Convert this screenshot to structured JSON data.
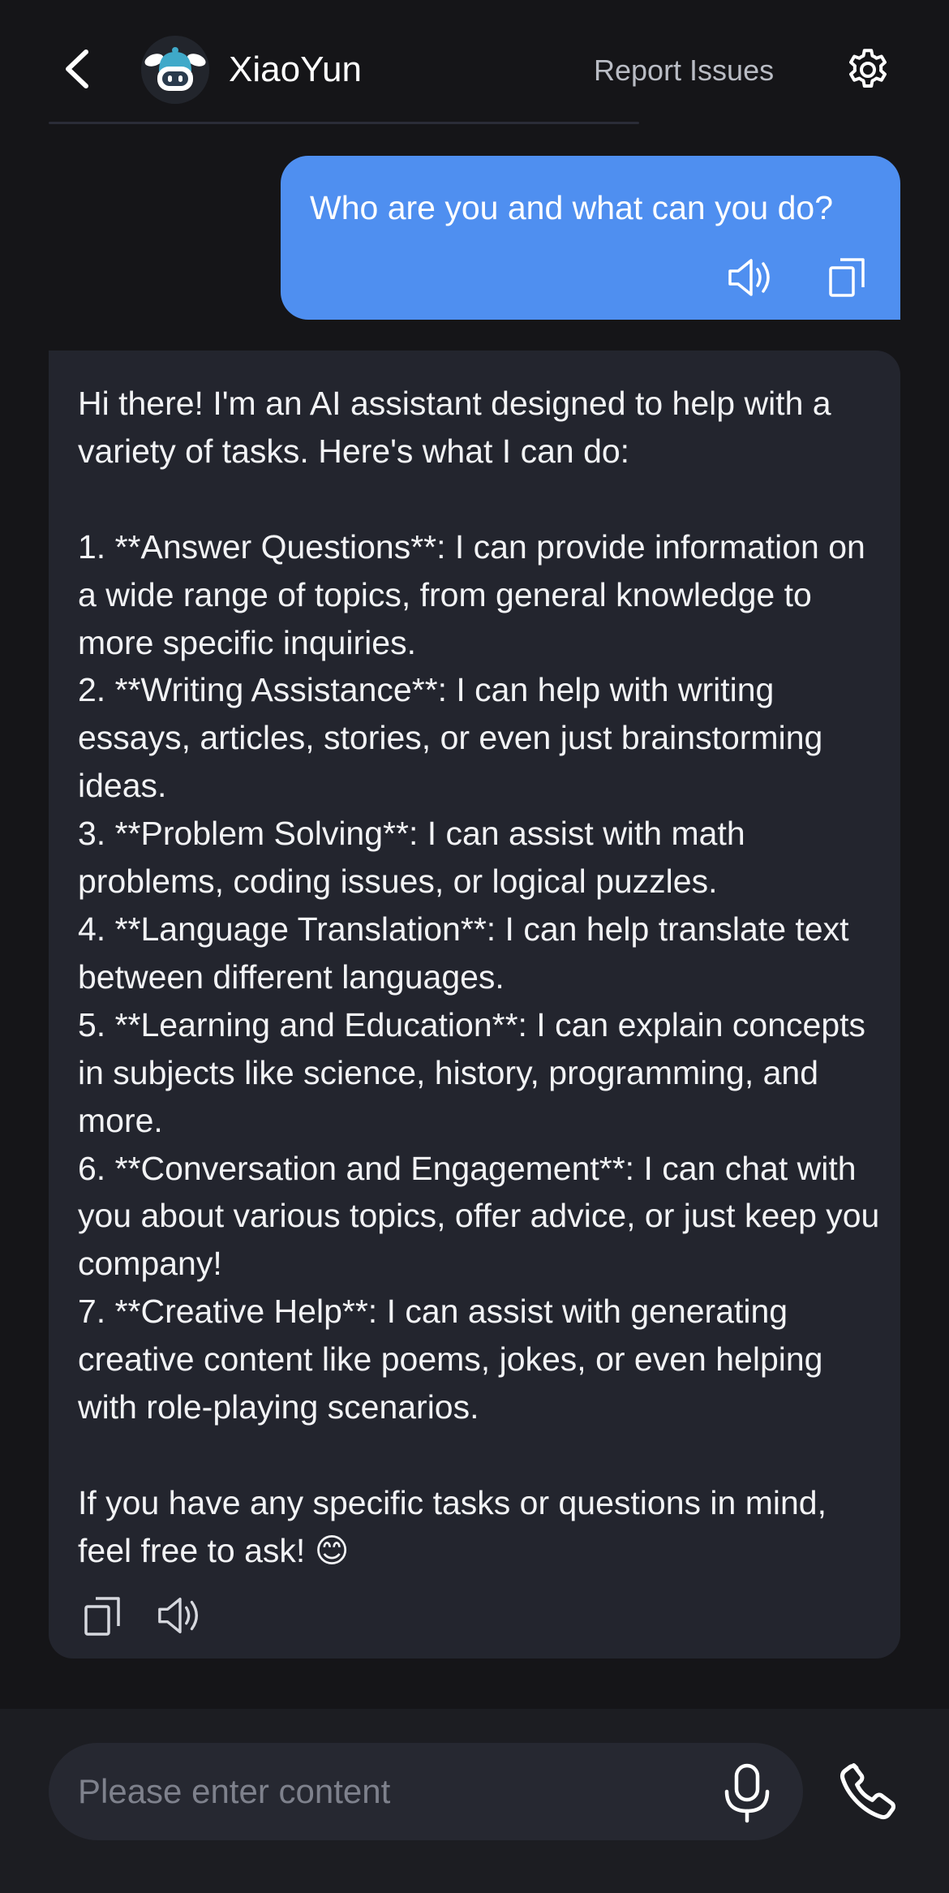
{
  "header": {
    "title": "XiaoYun",
    "report_label": "Report Issues",
    "back_icon": "chevron-left-icon",
    "settings_icon": "gear-icon",
    "avatar_icon": "robot-avatar"
  },
  "messages": {
    "user": {
      "text": "Who are you and what can you do?",
      "icons": [
        "speaker-icon",
        "copy-icon"
      ]
    },
    "assistant": {
      "text": "Hi there! I'm an AI assistant designed to help with a variety of tasks. Here's what I can do:\n\n1. **Answer Questions**: I can provide information on a wide range of topics, from general knowledge to more specific inquiries.\n2. **Writing Assistance**: I can help with writing essays, articles, stories, or even just brainstorming ideas.\n3. **Problem Solving**: I can assist with math problems, coding issues, or logical puzzles.\n4. **Language Translation**: I can help translate text between different languages.\n5. **Learning and Education**: I can explain concepts in subjects like science, history, programming, and more.\n6. **Conversation and Engagement**: I can chat with you about various topics, offer advice, or just keep you company!\n7. **Creative Help**: I can assist with generating creative content like poems, jokes, or even helping with role-playing scenarios.\n\nIf you have any specific tasks or questions in mind, feel free to ask! 😊",
      "icons": [
        "copy-icon",
        "speaker-icon"
      ]
    }
  },
  "input": {
    "placeholder": "Please enter content",
    "value": "",
    "mic_icon": "microphone-icon",
    "call_icon": "phone-icon"
  },
  "colors": {
    "background": "#151518",
    "user_bubble": "#4f8ff0",
    "assistant_bubble": "#23252e",
    "input_bar": "#1c1d22",
    "muted_text": "#b9bcc4"
  }
}
